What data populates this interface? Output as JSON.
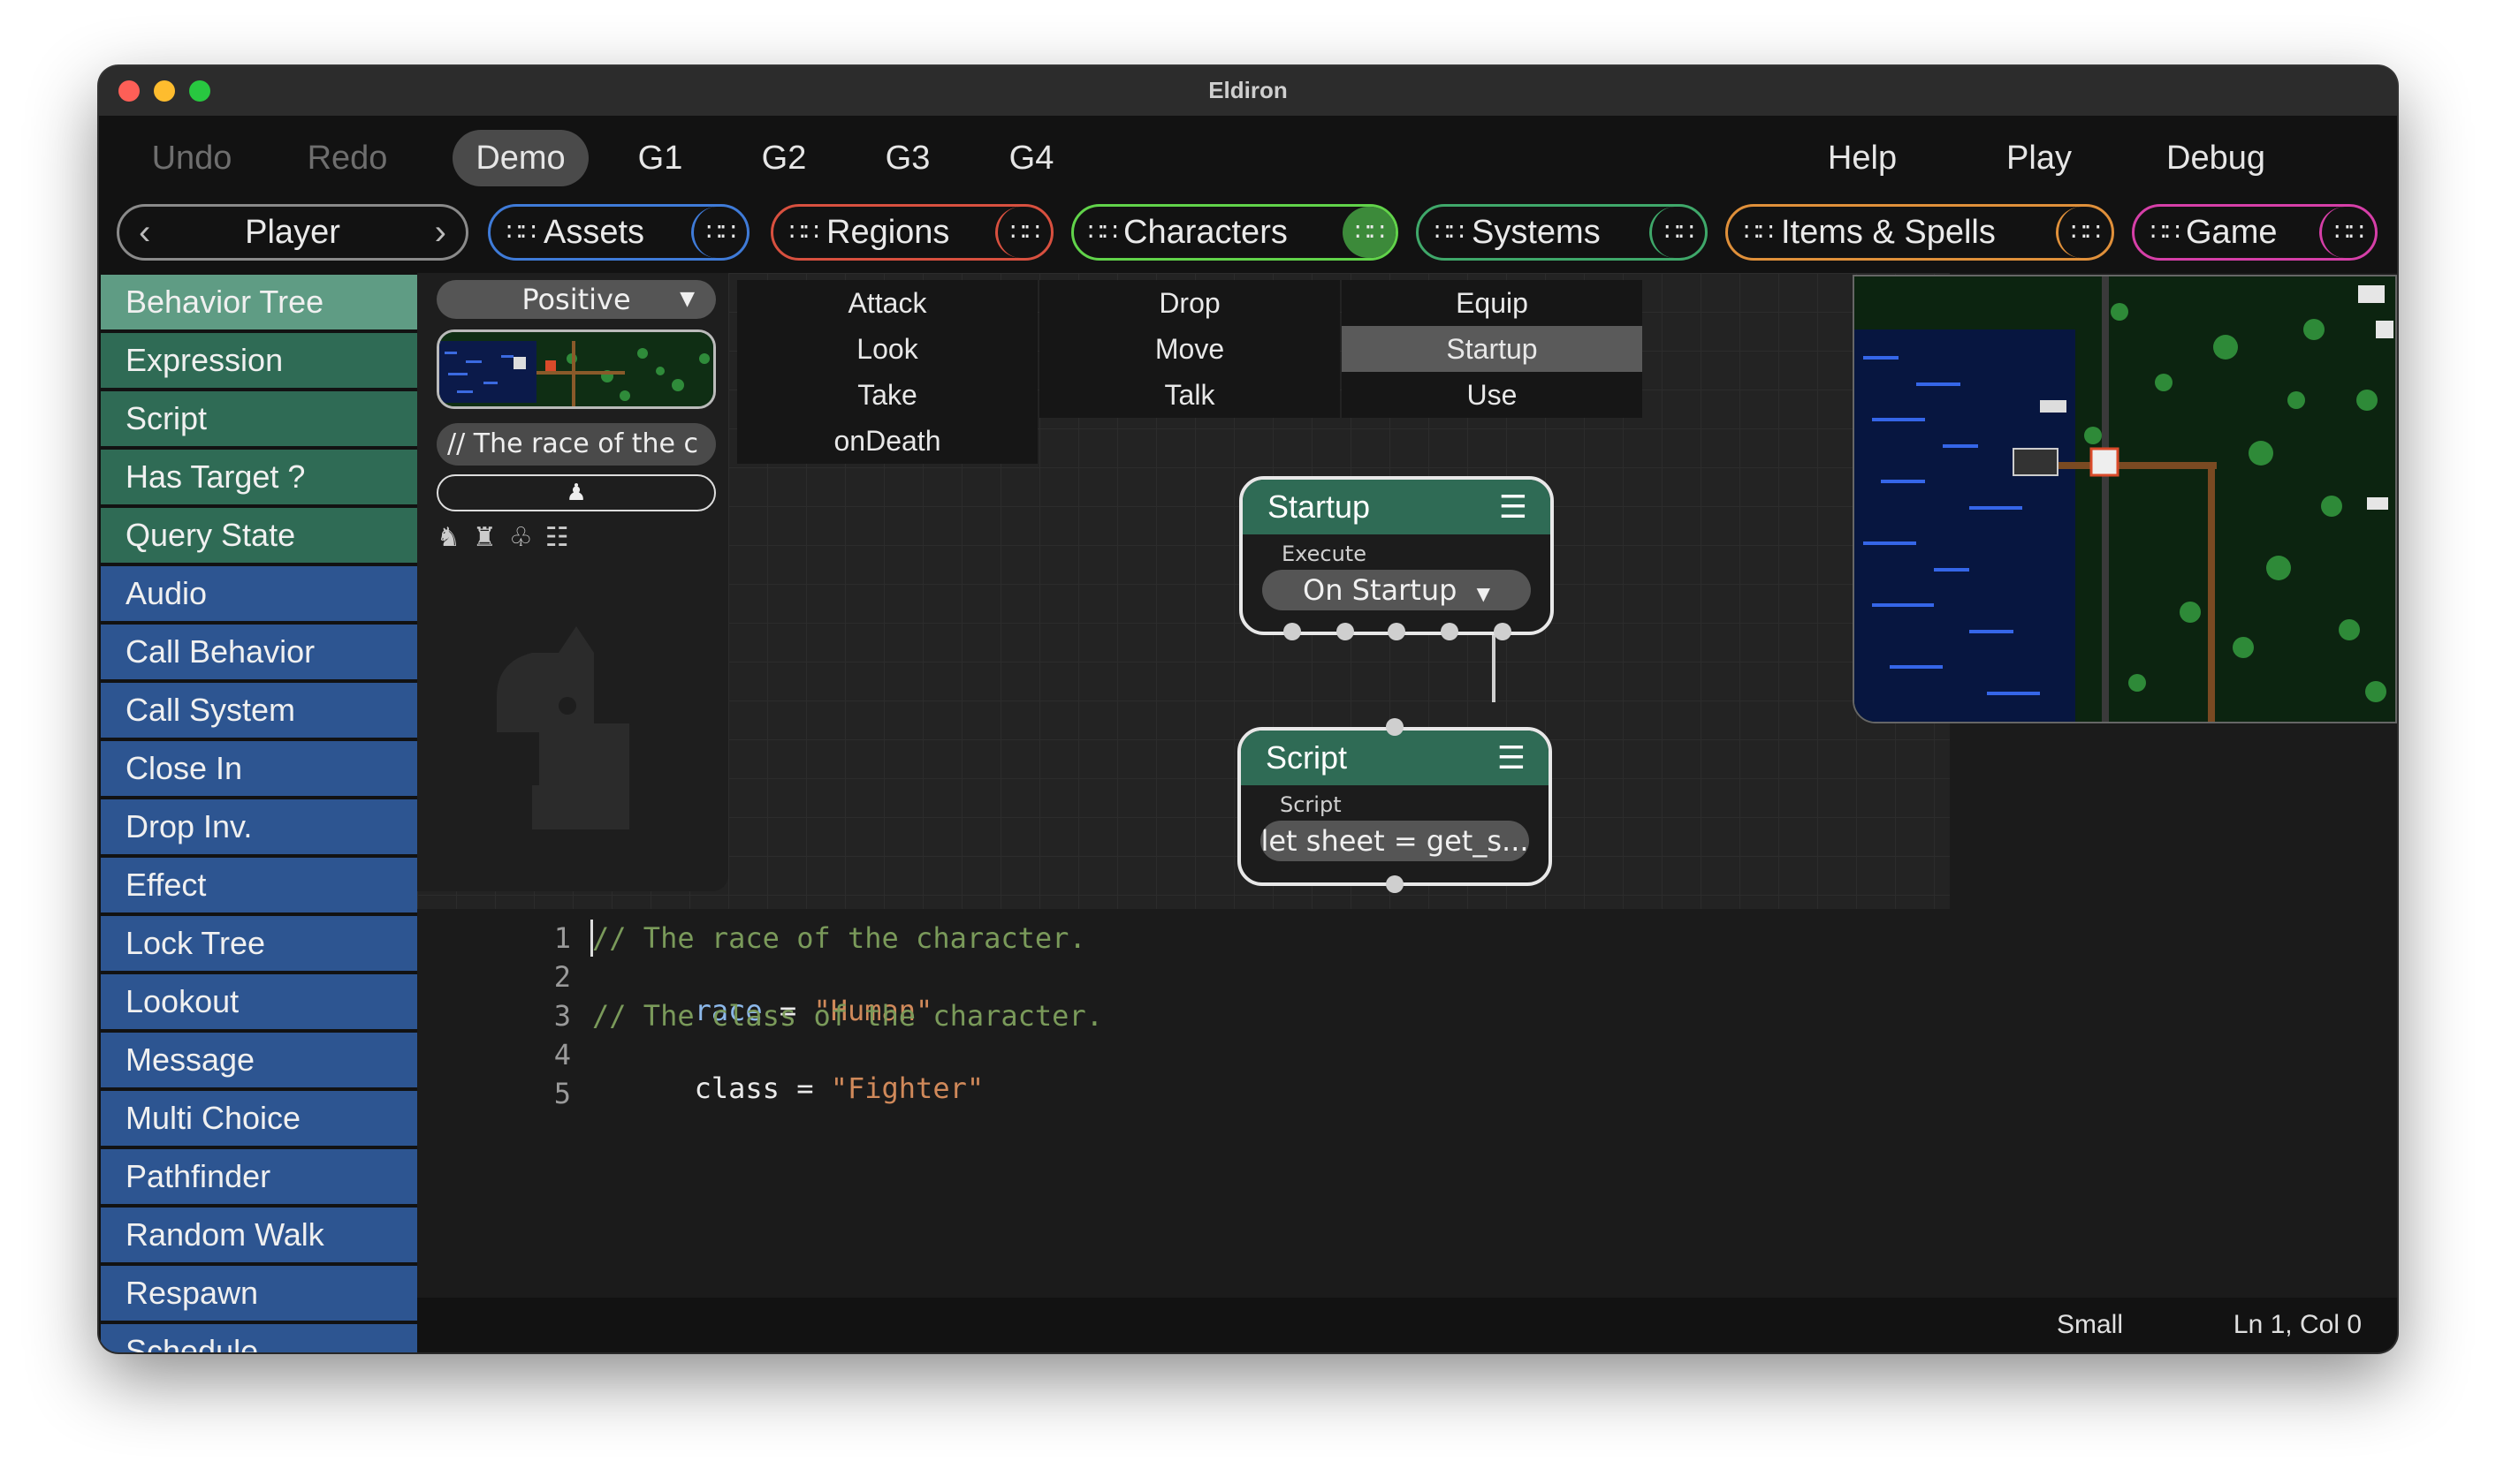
{
  "window": {
    "title": "Eldiron"
  },
  "menu": {
    "undo": "Undo",
    "redo": "Redo",
    "demo": "Demo",
    "g1": "G1",
    "g2": "G2",
    "g3": "G3",
    "g4": "G4",
    "help": "Help",
    "play": "Play",
    "debug": "Debug"
  },
  "toolbar": {
    "player": "Player",
    "assets": "Assets",
    "regions": "Regions",
    "characters": "Characters",
    "systems": "Systems",
    "items_spells": "Items & Spells",
    "game": "Game"
  },
  "sidebar": {
    "items": [
      {
        "label": "Behavior Tree"
      },
      {
        "label": "Expression"
      },
      {
        "label": "Script"
      },
      {
        "label": "Has Target ?"
      },
      {
        "label": "Query State"
      },
      {
        "label": "Audio"
      },
      {
        "label": "Call Behavior"
      },
      {
        "label": "Call System"
      },
      {
        "label": "Close In"
      },
      {
        "label": "Drop Inv."
      },
      {
        "label": "Effect"
      },
      {
        "label": "Lock Tree"
      },
      {
        "label": "Lookout"
      },
      {
        "label": "Message"
      },
      {
        "label": "Multi Choice"
      },
      {
        "label": "Pathfinder"
      },
      {
        "label": "Random Walk"
      },
      {
        "label": "Respawn"
      },
      {
        "label": "Schedule"
      }
    ]
  },
  "leftpanel": {
    "dropdown": "Positive",
    "text_preview": "// The race of the c"
  },
  "tabs": [
    "Attack",
    "Drop",
    "Equip",
    "Look",
    "Move",
    "Startup",
    "Take",
    "Talk",
    "Use",
    "onDeath"
  ],
  "nodes": {
    "startup": {
      "title": "Startup",
      "sub": "Execute",
      "value": "On Startup"
    },
    "script": {
      "title": "Script",
      "sub": "Script",
      "value": "let sheet = get_s..."
    }
  },
  "editor": {
    "lines": [
      {
        "num": "1",
        "text": "// The race of the character."
      },
      {
        "num": "2",
        "text_a": "race",
        "text_b": " = ",
        "text_c": "\"Human\""
      },
      {
        "num": "3",
        "text": "// The class of the character."
      },
      {
        "num": "4",
        "text_a": "class",
        "text_b": " = ",
        "text_c": "\"Fighter\""
      },
      {
        "num": "5",
        "text": ""
      }
    ]
  },
  "status": {
    "size": "Small",
    "position": "Ln 1, Col 0"
  },
  "colors": {
    "accent_green": "#2f6b55",
    "accent_blue": "#2d5591",
    "assets_border": "#3f7bd8",
    "regions_border": "#d8503f",
    "characters_border": "#61d34a",
    "systems_border": "#3fa86a",
    "items_border": "#e0903a",
    "game_border": "#d63fa8"
  }
}
